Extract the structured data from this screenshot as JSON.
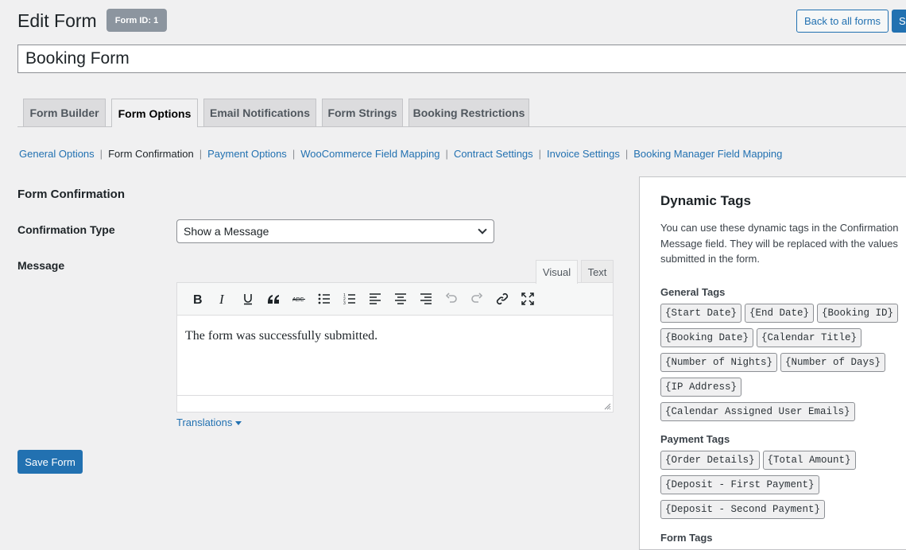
{
  "header": {
    "title": "Edit Form",
    "form_id_badge": "Form ID: 1",
    "back_label": "Back to all forms",
    "save_top_label": "S"
  },
  "form_title": {
    "value": "Booking Form"
  },
  "tabs": [
    {
      "label": "Form Builder"
    },
    {
      "label": "Form Options"
    },
    {
      "label": "Email Notifications"
    },
    {
      "label": "Form Strings"
    },
    {
      "label": "Booking Restrictions"
    }
  ],
  "subnav": [
    {
      "label": "General Options"
    },
    {
      "label": "Form Confirmation"
    },
    {
      "label": "Payment Options"
    },
    {
      "label": "WooCommerce Field Mapping"
    },
    {
      "label": "Contract Settings"
    },
    {
      "label": "Invoice Settings"
    },
    {
      "label": "Booking Manager Field Mapping"
    }
  ],
  "section": {
    "title": "Form Confirmation",
    "confirmation_type_label": "Confirmation Type",
    "confirmation_type_value": "Show a Message",
    "message_label": "Message"
  },
  "editor": {
    "tab_visual": "Visual",
    "tab_text": "Text",
    "content": "The form was successfully submitted.",
    "toolbar_icons": [
      "bold-icon",
      "italic-icon",
      "underline-icon",
      "blockquote-icon",
      "strikethrough-icon",
      "bullet-list-icon",
      "numbered-list-icon",
      "align-left-icon",
      "align-center-icon",
      "align-right-icon",
      "undo-icon",
      "redo-icon",
      "link-icon",
      "fullscreen-icon"
    ]
  },
  "translations_label": "Translations",
  "save_label": "Save Form",
  "panel": {
    "title": "Dynamic Tags",
    "description": "You can use these dynamic tags in the Confirmation Message field. They will be replaced with the values submitted in the form.",
    "general_title": "General Tags",
    "general_tags": [
      "{Start Date}",
      "{End Date}",
      "{Booking ID}",
      "{Booking Date}",
      "{Calendar Title}",
      "{Number of Nights}",
      "{Number of Days}",
      "{IP Address}",
      "{Calendar Assigned User Emails}"
    ],
    "payment_title": "Payment Tags",
    "payment_tags": [
      "{Order Details}",
      "{Total Amount}",
      "{Deposit - First Payment}",
      "{Deposit - Second Payment}"
    ],
    "form_title": "Form Tags"
  },
  "colors": {
    "accent": "#2271b1",
    "background": "#f0f0f1",
    "badge": "#8c959f"
  }
}
